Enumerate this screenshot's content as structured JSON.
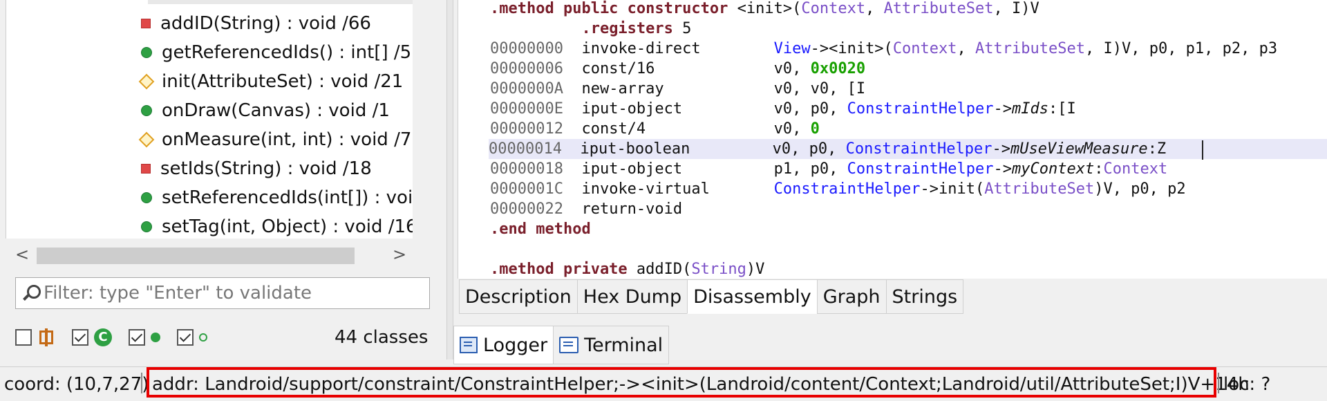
{
  "tree": {
    "items": [
      {
        "kind": "priv",
        "label": "addID(String) : void  /66"
      },
      {
        "kind": "pub",
        "label": "getReferencedIds() : int[]  /5"
      },
      {
        "kind": "prot",
        "label": "init(AttributeSet) : void  /21"
      },
      {
        "kind": "pub",
        "label": "onDraw(Canvas) : void  /1"
      },
      {
        "kind": "prot",
        "label": "onMeasure(int, int) : void  /7"
      },
      {
        "kind": "priv",
        "label": "setIds(String) : void  /18"
      },
      {
        "kind": "pub",
        "label": "setReferencedIds(int[]) : void"
      },
      {
        "kind": "pub",
        "label": "setTag(int, Object) : void  /16"
      }
    ],
    "scroll_down_glyph": "⌄",
    "scroll_left_glyph": "<",
    "scroll_right_glyph": ">"
  },
  "filter": {
    "placeholder": "Filter: type \"Enter\" to validate"
  },
  "toolbar": {
    "classes_count": "44 classes",
    "class_icon_letter": "C"
  },
  "code": {
    "lines": [
      ".method public constructor <init>(Context, AttributeSet, I)V",
      "          .registers 5",
      "00000000  invoke-direct        View-><init>(Context, AttributeSet, I)V, p0, p1, p2, p3",
      "00000006  const/16             v0, 0x0020",
      "0000000A  new-array            v0, v0, [I",
      "0000000E  iput-object          v0, p0, ConstraintHelper->mIds:[I",
      "00000012  const/4              v0, 0",
      "00000014  iput-boolean         v0, p0, ConstraintHelper->mUseViewMeasure:Z",
      "00000018  iput-object          p1, p0, ConstraintHelper->myContext:Context",
      "0000001C  invoke-virtual       ConstraintHelper->init(AttributeSet)V, p0, p2",
      "00000022  return-void",
      ".end method",
      "",
      ".method private addID(String)V"
    ]
  },
  "tabs": [
    "Description",
    "Hex Dump",
    "Disassembly",
    "Graph",
    "Strings"
  ],
  "active_tab": "Disassembly",
  "bottom_tabs": [
    "Logger",
    "Terminal"
  ],
  "status": {
    "coord": "coord: (10,7,27)",
    "addr": "addr: Landroid/support/constraint/ConstraintHelper;-><init>(Landroid/content/Context;Landroid/util/AttributeSet;I)V+14h",
    "loc": "loc: ?"
  },
  "colors": {
    "highlight_border": "#e80000",
    "keyword": "#7a1f2b",
    "class_ref": "#1a1aff",
    "type_ref": "#7a4fc7",
    "number": "#18a000"
  }
}
